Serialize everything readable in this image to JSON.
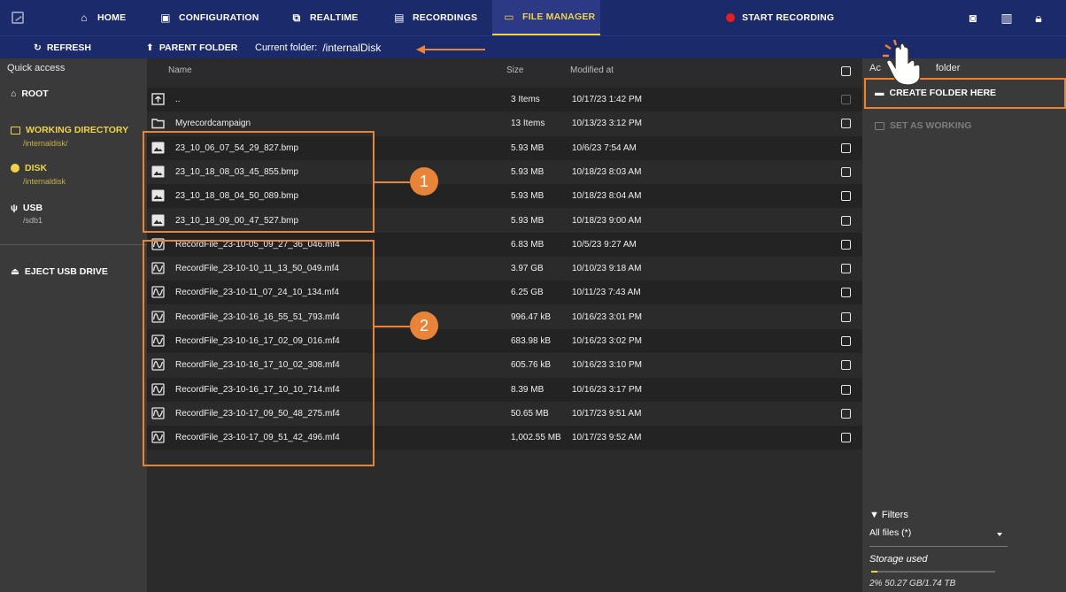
{
  "nav": {
    "tabs": [
      {
        "label": "HOME",
        "icon": "home-icon"
      },
      {
        "label": "CONFIGURATION",
        "icon": "sliders-icon"
      },
      {
        "label": "REALTIME",
        "icon": "realtime-icon"
      },
      {
        "label": "RECORDINGS",
        "icon": "recordings-icon"
      },
      {
        "label": "FILE MANAGER",
        "icon": "folder-icon"
      }
    ],
    "start_recording": "START RECORDING",
    "active_color": "#f0d24a",
    "record_color": "#e02020"
  },
  "toolbar": {
    "refresh": "REFRESH",
    "parent_folder": "PARENT FOLDER",
    "current_folder_label": "Current folder:",
    "current_folder_path": "/internalDisk"
  },
  "sidebar": {
    "title": "Quick access",
    "root": "ROOT",
    "working_directory": "WORKING DIRECTORY",
    "working_directory_path": "/internaldisk/",
    "disk": "DISK",
    "disk_path": "/internaldisk",
    "usb": "USB",
    "usb_path": "/sdb1",
    "eject": "EJECT USB DRIVE"
  },
  "table": {
    "headers": {
      "name": "Name",
      "size": "Size",
      "modified": "Modified at"
    },
    "rows": [
      {
        "name": "..",
        "size": "3 Items",
        "date": "10/17/23 1:42 PM",
        "type": "parent"
      },
      {
        "name": "Myrecordcampaign",
        "size": "13 Items",
        "date": "10/13/23 3:12 PM",
        "type": "folder"
      },
      {
        "name": "23_10_06_07_54_29_827.bmp",
        "size": "5.93 MB",
        "date": "10/6/23 7:54 AM",
        "type": "image"
      },
      {
        "name": "23_10_18_08_03_45_855.bmp",
        "size": "5.93 MB",
        "date": "10/18/23 8:03 AM",
        "type": "image"
      },
      {
        "name": "23_10_18_08_04_50_089.bmp",
        "size": "5.93 MB",
        "date": "10/18/23 8:04 AM",
        "type": "image"
      },
      {
        "name": "23_10_18_09_00_47_527.bmp",
        "size": "5.93 MB",
        "date": "10/18/23 9:00 AM",
        "type": "image"
      },
      {
        "name": "RecordFile_23-10-05_09_27_36_046.mf4",
        "size": "6.83 MB",
        "date": "10/5/23 9:27 AM",
        "type": "record"
      },
      {
        "name": "RecordFile_23-10-10_11_13_50_049.mf4",
        "size": "3.97 GB",
        "date": "10/10/23 9:18 AM",
        "type": "record"
      },
      {
        "name": "RecordFile_23-10-11_07_24_10_134.mf4",
        "size": "6.25 GB",
        "date": "10/11/23 7:43 AM",
        "type": "record"
      },
      {
        "name": "RecordFile_23-10-16_16_55_51_793.mf4",
        "size": "996.47 kB",
        "date": "10/16/23 3:01 PM",
        "type": "record"
      },
      {
        "name": "RecordFile_23-10-16_17_02_09_016.mf4",
        "size": "683.98 kB",
        "date": "10/16/23 3:02 PM",
        "type": "record"
      },
      {
        "name": "RecordFile_23-10-16_17_10_02_308.mf4",
        "size": "605.76 kB",
        "date": "10/16/23 3:10 PM",
        "type": "record"
      },
      {
        "name": "RecordFile_23-10-16_17_10_10_714.mf4",
        "size": "8.39 MB",
        "date": "10/16/23 3:17 PM",
        "type": "record"
      },
      {
        "name": "RecordFile_23-10-17_09_50_48_275.mf4",
        "size": "50.65 MB",
        "date": "10/17/23 9:51 AM",
        "type": "record"
      },
      {
        "name": "RecordFile_23-10-17_09_51_42_496.mf4",
        "size": "1,002.55 MB",
        "date": "10/17/23 9:52 AM",
        "type": "record"
      }
    ]
  },
  "rightpanel": {
    "title_start": "Ac",
    "title_end": "folder",
    "create_folder": "CREATE FOLDER HERE",
    "set_working": "SET AS WORKING",
    "filters": "Filters",
    "filter_value": "All files (*)",
    "storage_title": "Storage used",
    "storage_text": "2% 50.27 GB/1.74 TB",
    "storage_fraction": 0.02
  },
  "annotations": {
    "callout_1": "1",
    "callout_2": "2",
    "accent": "#e8833a"
  }
}
